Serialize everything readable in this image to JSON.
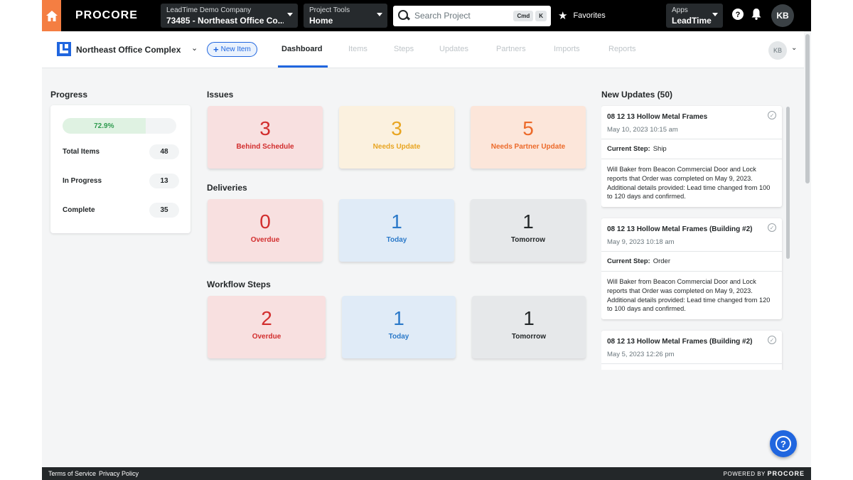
{
  "topnav": {
    "brand": "PROCORE",
    "company": {
      "label": "LeadTime Demo Company",
      "value": "73485 - Northeast Office Co..."
    },
    "tools": {
      "label": "Project Tools",
      "value": "Home"
    },
    "search": {
      "placeholder": "Search Project",
      "kbd1": "Cmd",
      "kbd2": "K"
    },
    "favorites": "Favorites",
    "apps": {
      "label": "Apps",
      "value": "LeadTime"
    },
    "avatar": "KB"
  },
  "projbar": {
    "project_name": "Northeast Office Complex",
    "new_item": "New Item",
    "tabs": [
      "Dashboard",
      "Items",
      "Steps",
      "Updates",
      "Partners",
      "Imports",
      "Reports"
    ],
    "user": "KB"
  },
  "progress": {
    "title": "Progress",
    "percent_label": "72.9%",
    "fraction": 0.729,
    "stats": [
      {
        "label": "Total Items",
        "value": "48"
      },
      {
        "label": "In Progress",
        "value": "13"
      },
      {
        "label": "Complete",
        "value": "35"
      }
    ]
  },
  "issues": {
    "title": "Issues",
    "tiles": [
      {
        "num": "3",
        "label": "Behind Schedule"
      },
      {
        "num": "3",
        "label": "Needs Update"
      },
      {
        "num": "5",
        "label": "Needs Partner Update"
      }
    ]
  },
  "deliveries": {
    "title": "Deliveries",
    "tiles": [
      {
        "num": "0",
        "label": "Overdue"
      },
      {
        "num": "1",
        "label": "Today"
      },
      {
        "num": "1",
        "label": "Tomorrow"
      }
    ]
  },
  "workflow": {
    "title": "Workflow Steps",
    "tiles": [
      {
        "num": "2",
        "label": "Overdue"
      },
      {
        "num": "1",
        "label": "Today"
      },
      {
        "num": "1",
        "label": "Tomorrow"
      }
    ]
  },
  "updates": {
    "title": "New Updates (50)",
    "step_label": "Current Step:",
    "items": [
      {
        "title": "08 12 13 Hollow Metal Frames",
        "date": "May 10, 2023 10:15 am",
        "step": "Ship",
        "body": "Will Baker from Beacon Commercial Door and Lock reports that Order was completed on May 9, 2023. Additional details provided: Lead time changed from 100 to 120 days and confirmed."
      },
      {
        "title": "08 12 13 Hollow Metal Frames (Building #2)",
        "date": "May 9, 2023 10:18 am",
        "step": "Order",
        "body": "Will Baker from Beacon Commercial Door and Lock reports that Order was completed on May 9, 2023. Additional details provided: Lead time changed from 120 to 100 days and confirmed."
      },
      {
        "title": "08 12 13 Hollow Metal Frames (Building #2)",
        "date": "May 5, 2023 12:26 pm"
      }
    ]
  },
  "footer": {
    "terms": "Terms of Service",
    "privacy": "Privacy Policy",
    "powered": "POWERED BY",
    "powered_brand": "PROCORE"
  },
  "colors": {
    "accent": "#2066df",
    "brand_orange": "#f47e42",
    "red": "#d22e2e",
    "yellow": "#e8a521",
    "orange": "#ec6a2a",
    "blue": "#2b79c9"
  }
}
